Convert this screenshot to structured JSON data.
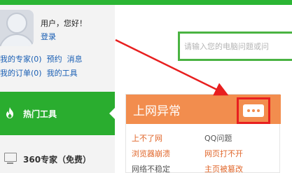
{
  "colors": {
    "brand_green": "#2bb534",
    "sidebar_active": "#2aad2f",
    "card_header": "#f28d4e",
    "annotation_red": "#e81f1f",
    "link_blue": "#1a5fb4",
    "link_orange": "#e0662a"
  },
  "user": {
    "greeting": "用户，您好！",
    "login": "登录",
    "avatar_icon": "user-avatar-icon"
  },
  "sidebar": {
    "links_row1": [
      "我的专家(0)",
      "预约",
      "消息"
    ],
    "links_row2": [
      "我的订单(0)",
      "我的工具"
    ],
    "active_item": {
      "label": "热门工具",
      "icon": "flame-icon"
    },
    "item2": {
      "label": "360专家（免费）",
      "icon": "monitor-icon"
    }
  },
  "search": {
    "placeholder": "请输入您的电脑问题或问"
  },
  "card": {
    "title": "上网异常",
    "more_icon": "more-dots-icon",
    "links": [
      [
        "上不了网",
        "QQ问题"
      ],
      [
        "浏览器崩溃",
        "网页打不开"
      ],
      [
        "网络不稳定",
        "主页被篡改"
      ]
    ]
  }
}
